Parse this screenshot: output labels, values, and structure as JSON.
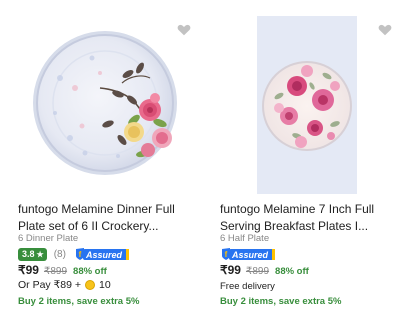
{
  "products": [
    {
      "title": "funtogo Melamine Dinner Full Plate set of 6 II Crockery...",
      "subtitle": "6 Dinner Plate",
      "rating": "3.8",
      "rating_star": "★",
      "rating_count": "(8)",
      "assured_label": "Assured",
      "price": "₹99",
      "mrp": "₹899",
      "discount": "88% off",
      "pay_prefix": "Or Pay ₹89 +",
      "coins": "10",
      "offer": "Buy 2 items, save extra 5%",
      "image_icon": "flower-dinner-plate-image",
      "wishlist_icon": "heart-icon"
    },
    {
      "title": "funtogo Melamine 7 Inch Full Serving Breakfast Plates I...",
      "subtitle": "6 Half Plate",
      "assured_label": "Assured",
      "price": "₹99",
      "mrp": "₹899",
      "discount": "88% off",
      "delivery": "Free delivery",
      "offer": "Buy 2 items, save extra 5%",
      "image_icon": "rose-half-plate-image",
      "wishlist_icon": "heart-icon"
    }
  ],
  "colors": {
    "rating_green": "#388e3c",
    "assured_blue": "#2874f0",
    "assured_gold": "#ffc200",
    "muted_text": "#878787",
    "coin_gold": "#f7c31b"
  }
}
